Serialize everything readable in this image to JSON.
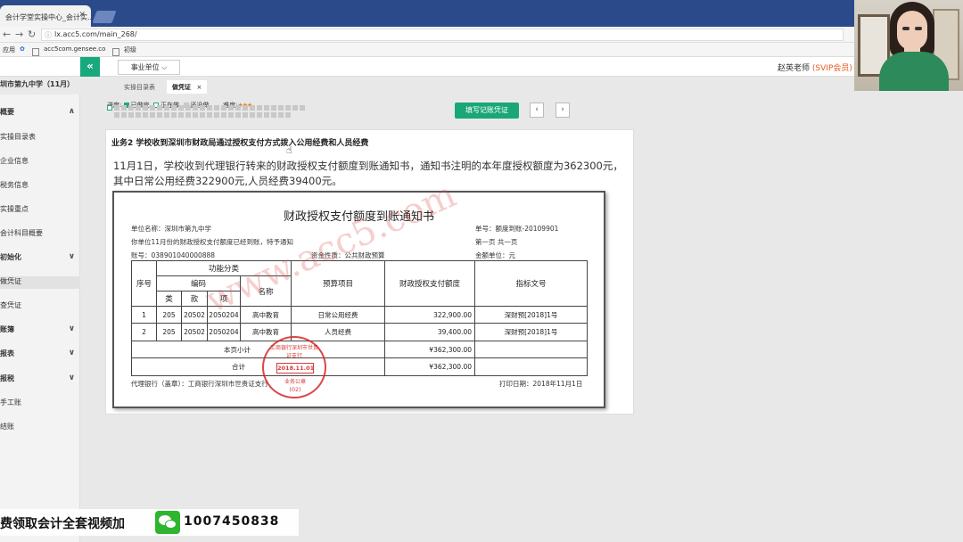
{
  "browser": {
    "tab_title": "会计学堂实操中心_会计实...",
    "url": "lx.acc5.com/main_268/",
    "bookmarks": [
      "应用",
      "acc5com.gensee.co",
      "初级"
    ]
  },
  "header": {
    "unit_select": "事业单位",
    "teacher": "赵英老师",
    "vip": "(SVIP会员)"
  },
  "sidebar": {
    "school": "圳市第九中学（11月）",
    "items": [
      {
        "label": "概要",
        "chevron": "∧"
      },
      {
        "label": "实操目录表"
      },
      {
        "label": "企业信息"
      },
      {
        "label": "税务信息"
      },
      {
        "label": "实操重点"
      },
      {
        "label": "会计科目概要"
      },
      {
        "label": "初始化",
        "chevron": "∨"
      },
      {
        "label": "做凭证"
      },
      {
        "label": "查凭证"
      },
      {
        "label": "账簿",
        "chevron": "∨"
      },
      {
        "label": "报表",
        "chevron": "∨"
      },
      {
        "label": "报税",
        "chevron": "∨"
      },
      {
        "label": "手工账"
      },
      {
        "label": "结账"
      }
    ]
  },
  "subtabs": {
    "catalog": "实操目录表",
    "voucher": "做凭证",
    "close": "×"
  },
  "progress": {
    "label": "进度:",
    "done": "已做完",
    "doing": "正在做",
    "todo": "还没做",
    "difficulty": "难度:",
    "stars": "★★★",
    "done_count": 1,
    "total_cells": 53
  },
  "actions": {
    "write_voucher": "填写记账凭证",
    "prev": "‹",
    "next": "›"
  },
  "business": {
    "title": "业务2 学校收到深圳市财政局通过授权支付方式拨入公用经费和人员经费",
    "description": "11月1日，学校收到代理银行转来的财政授权支付额度到账通知书，通知书注明的本年度授权额度为362300元，其中日常公用经费322900元,人员经费39400元。"
  },
  "document": {
    "title": "财政授权支付额度到账通知书",
    "unit_name": "单位名称：深圳市第九中学",
    "doc_no": "单号：额度到账-20109901",
    "notice": "你单位11月份的财政授权支付额度已经到账，特予通知",
    "page": "第一页  共一页",
    "account": "账号：038901040000888",
    "fund_nature": "资金性质：公共财政预算",
    "amount_unit": "金额单位：元",
    "headers": {
      "seq": "序号",
      "func": "功能分类",
      "code": "编码",
      "lei": "类",
      "kuan": "款",
      "xiang": "项",
      "name": "名称",
      "budget_item": "预算项目",
      "quota": "财政授权支付额度",
      "doc_num": "指标文号"
    },
    "rows": [
      {
        "seq": "1",
        "lei": "205",
        "kuan": "20502",
        "xiang": "2050204",
        "name": "高中教育",
        "item": "日常公用经费",
        "amount": "322,900.00",
        "doc": "深财预[2018]1号"
      },
      {
        "seq": "2",
        "lei": "205",
        "kuan": "20502",
        "xiang": "2050204",
        "name": "高中教育",
        "item": "人员经费",
        "amount": "39,400.00",
        "doc": "深财预[2018]1号"
      }
    ],
    "subtotal_label": "本页小计",
    "subtotal": "¥362,300.00",
    "total_label": "合计",
    "total": "¥362,300.00",
    "agent_bank": "代理银行（盖章）：工商银行深圳市世贵证支行",
    "print_date": "打印日期：2018年11月1日",
    "watermark": "www.acc5.com",
    "stamp": {
      "arc": "工商银行深圳市世贵证支行",
      "date": "2018.11.01",
      "bottom": "业务公章",
      "code": "(02)"
    }
  },
  "banner": {
    "text": "费领取会计全套视频加",
    "number": "1007450838"
  },
  "colors": {
    "accent": "#18a87e",
    "vip": "#e65a20",
    "stamp": "#d22828"
  }
}
